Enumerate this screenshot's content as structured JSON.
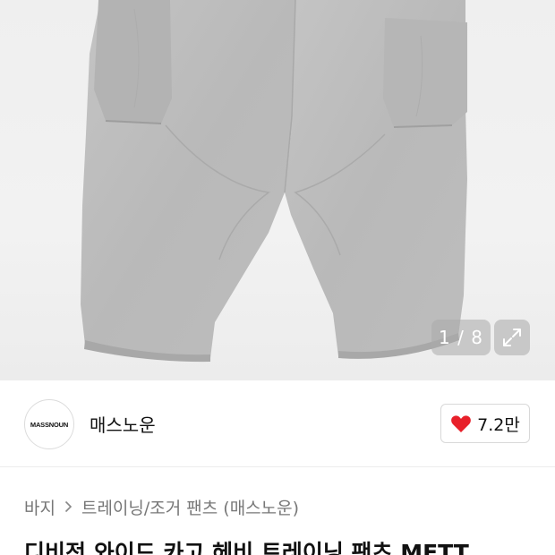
{
  "gallery": {
    "counter": "1 / 8"
  },
  "brand": {
    "logo_text": "MASSNOUN",
    "name": "매스노운"
  },
  "like": {
    "count": "7.2만",
    "color": "#e8202a"
  },
  "breadcrumb": {
    "items": [
      "바지",
      "트레이닝/조거 팬츠 (매스노운)"
    ]
  },
  "product": {
    "title": "디비전 와이드 카고 헤비 트레이닝 팬츠 MFTT"
  }
}
